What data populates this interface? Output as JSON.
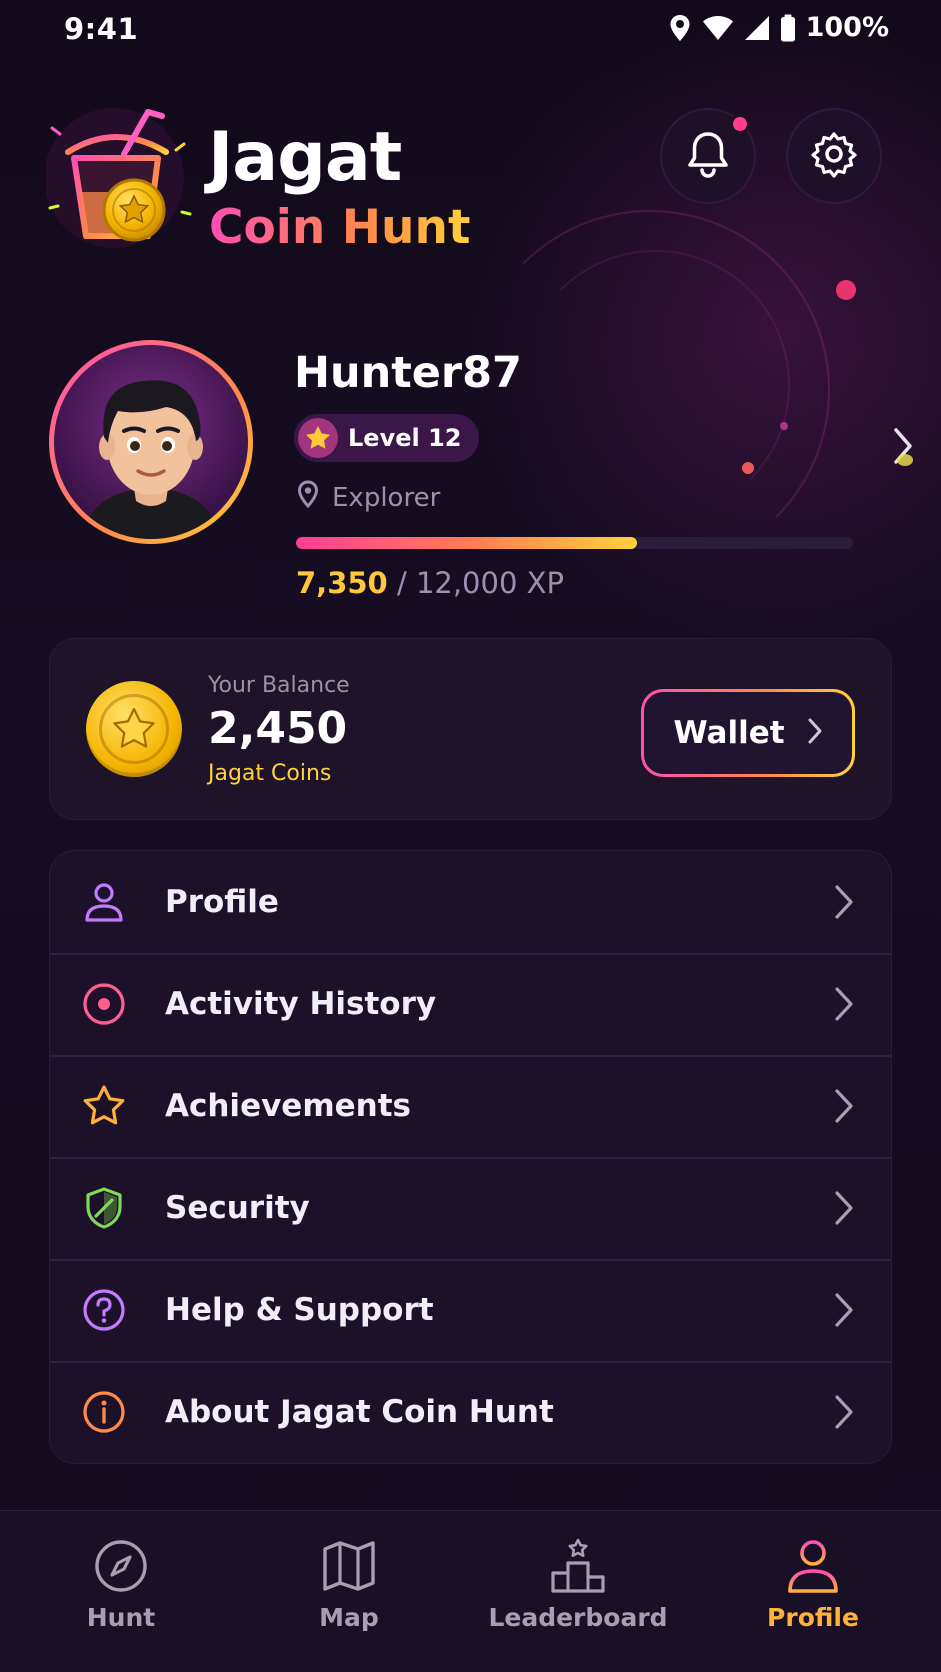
{
  "status_bar": {
    "time": "9:41",
    "battery": "100%"
  },
  "header": {
    "title_line1": "Jagat",
    "title_line2": "Coin Hunt",
    "has_notification": true
  },
  "profile": {
    "username": "Hunter87",
    "level": "Level 12",
    "rank": "Explorer",
    "xp_current": "7,350",
    "xp_rest": " / 12,000 XP",
    "xp_progress": 0.6125
  },
  "balance": {
    "label": "Your Balance",
    "value": "2,450",
    "unit": "Jagat Coins",
    "wallet_label": "Wallet"
  },
  "menu": {
    "items": [
      {
        "label": "Profile",
        "icon": "person-icon",
        "color": "#c07bff"
      },
      {
        "label": "Activity History",
        "icon": "target-icon",
        "color": "#ff5e92"
      },
      {
        "label": "Achievements",
        "icon": "star-icon",
        "color": "#ffb13a"
      },
      {
        "label": "Security",
        "icon": "shield-icon",
        "color": "#7ed957"
      },
      {
        "label": "Help & Support",
        "icon": "question-icon",
        "color": "#c07bff"
      },
      {
        "label": "About Jagat Coin Hunt",
        "icon": "info-icon",
        "color": "#ff8a4a"
      }
    ]
  },
  "bottom_nav": {
    "items": [
      {
        "label": "Hunt",
        "icon": "compass-icon"
      },
      {
        "label": "Map",
        "icon": "map-icon"
      },
      {
        "label": "Leaderboard",
        "icon": "podium-icon"
      },
      {
        "label": "Profile",
        "icon": "person-icon",
        "active": true
      }
    ]
  },
  "colors": {
    "accent_pink": "#ff4fb3",
    "accent_orange": "#ff8a4a",
    "accent_yellow": "#ffd23a",
    "background": "#130b1c"
  }
}
